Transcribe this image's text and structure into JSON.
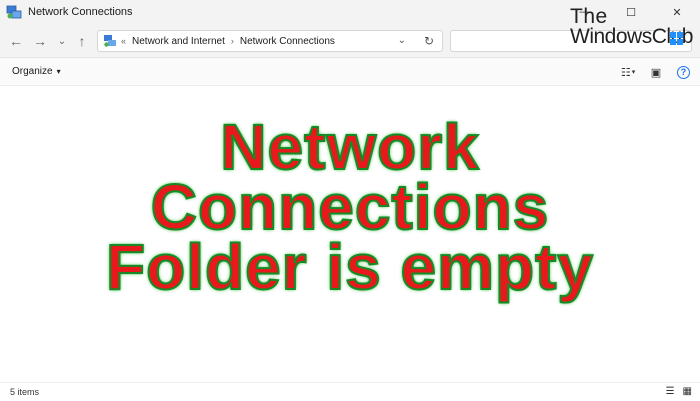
{
  "window": {
    "title": "Network Connections",
    "minimize_icon": "—",
    "maximize_icon": "☐",
    "close_icon": "✕"
  },
  "watermark": {
    "line1": "The",
    "line2": "WindowsClub"
  },
  "navigation": {
    "back_icon": "←",
    "forward_icon": "→",
    "recent_icon": "⌄",
    "up_icon": "↑"
  },
  "address": {
    "overflow": "«",
    "crumbs": [
      "Network and Internet",
      "Network Connections"
    ],
    "separator": "›",
    "dropdown_icon": "⌄",
    "refresh_icon": "↻"
  },
  "search": {
    "placeholder": ""
  },
  "command_bar": {
    "organize_label": "Organize",
    "organize_caret": "▾",
    "view_icon": "☷",
    "view_caret": "▾",
    "pane_icon": "▣",
    "help_icon": "?"
  },
  "headline": {
    "line1": "Network",
    "line2": "Connections",
    "line3": "Folder is empty"
  },
  "status": {
    "item_count": "5 items",
    "details_view_icon": "☰",
    "tiles_view_icon": "▦"
  },
  "colors": {
    "headline_fill": "#e8191c",
    "headline_outline": "#168a24",
    "chrome_background": "#f3f3f3",
    "help_accent": "#1a73e8"
  }
}
